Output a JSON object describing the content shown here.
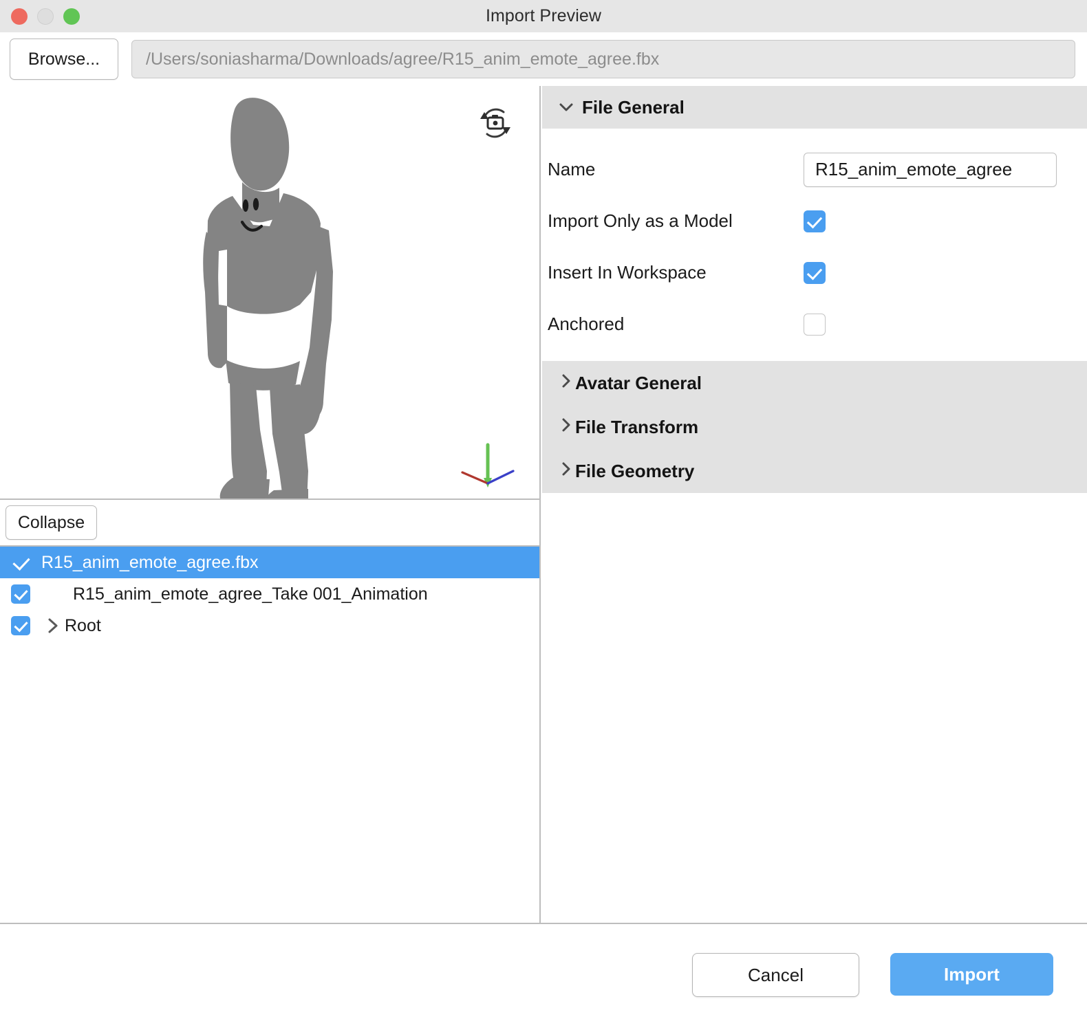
{
  "window": {
    "title": "Import Preview",
    "traffic_lights": [
      "close-red",
      "minimize-gray",
      "zoom-green"
    ]
  },
  "pathbar": {
    "browse_label": "Browse...",
    "path_value": "/Users/soniasharma/Downloads/agree/R15_anim_emote_agree.fbx"
  },
  "viewport": {
    "rotate_camera_icon": "camera-rotate-icon",
    "axis_gizmo": {
      "y_color": "#66c153",
      "x_color": "#b0382f",
      "z_color": "#3a40c8"
    },
    "avatar_color": "#848484"
  },
  "tree_toolbar": {
    "collapse_label": "Collapse"
  },
  "tree": {
    "rows": [
      {
        "label": "R15_anim_emote_agree.fbx",
        "checked": true,
        "selected": true,
        "indent": 0,
        "has_chevron": false
      },
      {
        "label": "R15_anim_emote_agree_Take 001_Animation",
        "checked": true,
        "selected": false,
        "indent": 1,
        "has_chevron": false
      },
      {
        "label": "Root",
        "checked": true,
        "selected": false,
        "indent": 0,
        "has_chevron": true
      }
    ]
  },
  "properties": {
    "file_general": {
      "title": "File General",
      "expanded": true,
      "name_label": "Name",
      "name_value": "R15_anim_emote_agree",
      "import_only_label": "Import Only as a Model",
      "import_only_checked": true,
      "insert_workspace_label": "Insert In Workspace",
      "insert_workspace_checked": true,
      "anchored_label": "Anchored",
      "anchored_checked": false
    },
    "collapsed_sections": [
      {
        "title": "Avatar General"
      },
      {
        "title": "File Transform"
      },
      {
        "title": "File Geometry"
      }
    ]
  },
  "footer": {
    "cancel_label": "Cancel",
    "import_label": "Import"
  },
  "colors": {
    "accent": "#4a9ef0",
    "import_button": "#5aaaf2",
    "section_header_bg": "#e2e2e2",
    "titlebar_bg": "#e6e6e6"
  }
}
